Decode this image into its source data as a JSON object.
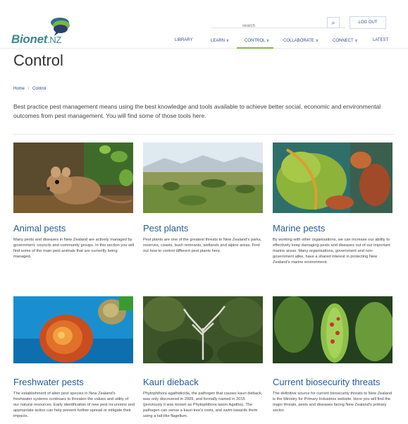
{
  "header": {
    "brand_main": "Bionet",
    "brand_suffix": ".NZ",
    "search_placeholder": "search",
    "logout_label": "LOG OUT"
  },
  "nav": [
    {
      "label": "LIBRARY"
    },
    {
      "label": "LEARN ∨"
    },
    {
      "label": "CONTROL ∨"
    },
    {
      "label": "COLLABORATE ∨"
    },
    {
      "label": "CONNECT ∨"
    },
    {
      "label": "LATEST"
    }
  ],
  "page": {
    "title": "Control",
    "breadcrumb_home": "Home",
    "breadcrumb_sep": "/",
    "breadcrumb_current": "Control",
    "intro": "Best practice pest management means using the best knowledge and tools available to achieve better social, economic and environmental outcomes from pest management. You will find some of those tools here."
  },
  "cards": [
    {
      "title": "Animal pests",
      "text": "Many pests and diseases in New Zealand are actively managed by government, councils and community groups. In this section you will find some of the main pest animals that are currently being managed."
    },
    {
      "title": "Pest plants",
      "text": "Pest plants are one of the greatest threats to New Zealand's parks, reserves, coasts, bush remnants, wetlands and alpine areas. Find out how to control different pest plants here."
    },
    {
      "title": "Marine pests",
      "text": "By working with other organisations, we can increase our ability to effectively keep damaging pests and diseases out of our important marine areas. Many organisations, government and non-government alike, have a shared interest in protecting New Zealand's marine environment."
    },
    {
      "title": "Freshwater pests",
      "text": "The establishment of alien pest species in New Zealand's freshwater systems continues to threaten the values and utility of our natural resources. Early identification of new pest incursions and appropriate action can help prevent further spread or mitigate their impacts."
    },
    {
      "title": "Kauri dieback",
      "text": "Phytophthora agathidicida, the pathogen that causes kauri dieback, was only discovered in 2009, and formally named in 2015 (previously it was known as Phytophthora taxon Agathis). The pathogen can sense a kauri tree's roots, and swim towards them using a tail-like flagellum."
    },
    {
      "title": "Current biosecurity threats",
      "text": "The definitive source for current biosecurity threats to New Zealand is the Ministry for Primary Industries website. Here you will find the major threats, pests and diseases facing New Zealand's primary sector."
    }
  ]
}
